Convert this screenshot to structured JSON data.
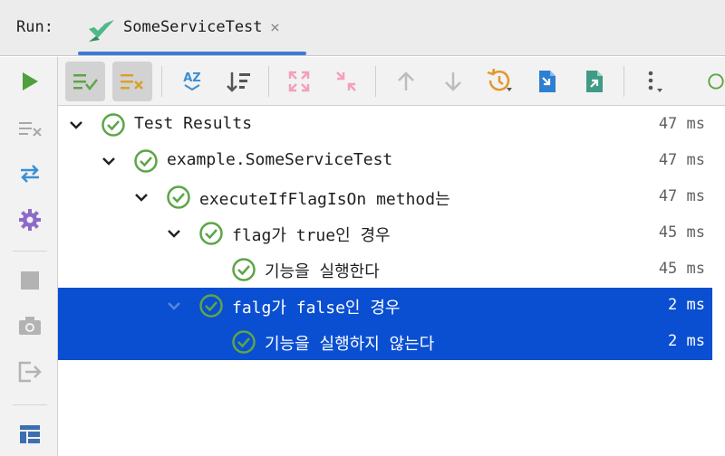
{
  "run_label": "Run:",
  "tab": {
    "title": "SomeServiceTest",
    "close_glyph": "×"
  },
  "colors": {
    "pass": "#5ca547",
    "selection": "#0a4fd1",
    "accent_blue": "#3d7bd6",
    "run_green": "#4f9f3e",
    "toolbar_bg": "#f2f2f2"
  },
  "sidebar": {
    "icons": [
      "run-icon",
      "clear-icon",
      "toggle-auto-test-icon",
      "settings-icon",
      "stop-icon",
      "screenshot-icon",
      "exit-icon",
      "layout-icon"
    ]
  },
  "toolbar": {
    "buttons": [
      "show-passed-icon",
      "show-ignored-icon",
      "sort-alphabetically-icon",
      "sort-by-duration-icon",
      "expand-all-icon",
      "collapse-all-icon",
      "previous-failed-icon",
      "next-failed-icon",
      "test-history-icon",
      "import-tests-icon",
      "export-tests-icon",
      "more-icon",
      "rerun-icon"
    ],
    "sort_alpha_text": "AZ"
  },
  "tree": {
    "rows": [
      {
        "label": "Test Results",
        "duration": "47 ms",
        "expanded": true,
        "selected": false
      },
      {
        "label": "example.SomeServiceTest",
        "duration": "47 ms",
        "expanded": true,
        "selected": false
      },
      {
        "label": "executeIfFlagIsOn method는",
        "duration": "47 ms",
        "expanded": true,
        "selected": false
      },
      {
        "label": "flag가 true인 경우",
        "duration": "45 ms",
        "expanded": true,
        "selected": false
      },
      {
        "label": "기능을 실행한다",
        "duration": "45 ms",
        "expanded": false,
        "selected": false
      },
      {
        "label": "falg가 false인 경우",
        "duration": "2 ms",
        "expanded": true,
        "selected": true
      },
      {
        "label": "기능을 실행하지 않는다",
        "duration": "2 ms",
        "expanded": false,
        "selected": true
      }
    ]
  }
}
